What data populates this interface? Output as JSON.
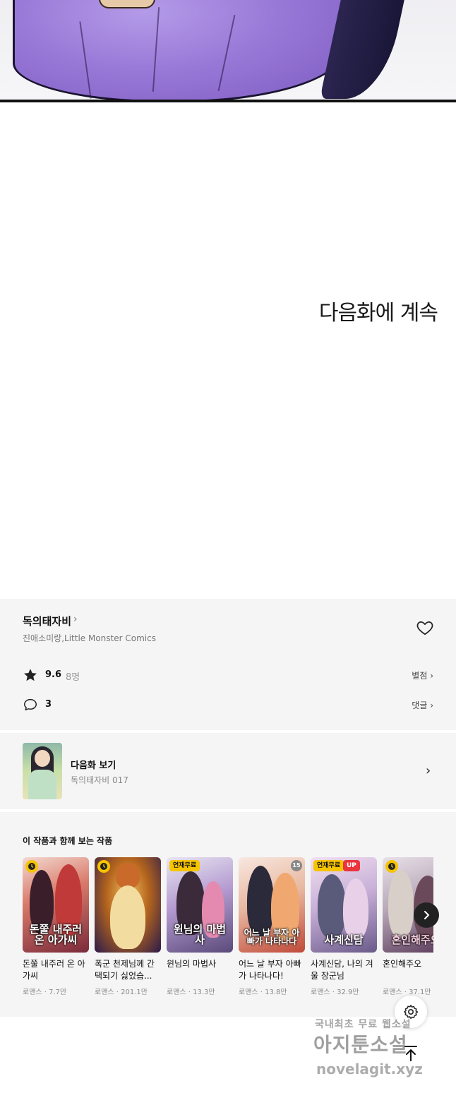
{
  "reader": {
    "continue_text": "다음화에 계속"
  },
  "series": {
    "title": "독의태자비",
    "title_chevron": "›",
    "authors": "진애소미랑,Little Monster Comics",
    "rating": "9.6",
    "rating_count": "8명",
    "rate_link": "별점 ›",
    "comment_count": "3",
    "comment_link": "댓글 ›"
  },
  "next_episode": {
    "label": "다음화 보기",
    "subtitle": "독의태자비 017",
    "chevron": "›"
  },
  "recommendations": {
    "heading": "이 작품과 함께 보는 작품",
    "items": [
      {
        "name": "돈쭐 내주러 온 아가씨",
        "meta": "로맨스 · 7.7만",
        "cover_text": "돈쭐 내주러 온 아가씨",
        "badge": "clock"
      },
      {
        "name": "폭군 천제님께 간택되기 싫었습...",
        "meta": "로맨스 · 201.1만",
        "cover_text": "",
        "badge": "clock"
      },
      {
        "name": "윈님의 마법사",
        "meta": "로맨스 · 13.3만",
        "cover_text": "윈님의 마법사",
        "badge": "free",
        "badge_label": "연재무료"
      },
      {
        "name": "어느 날 부자 아빠가 나타나다!",
        "meta": "로맨스 · 13.8만",
        "cover_text": "어느 날 부자 아빠가 나타나다",
        "badge": "age",
        "badge_label": "15"
      },
      {
        "name": "사계신담, 나의 겨울 장군님",
        "meta": "로맨스 · 32.9만",
        "cover_text": "사계신담",
        "badge": "free",
        "badge_label": "연재무료",
        "badge2": "UP"
      },
      {
        "name": "혼인해주오",
        "meta": "로맨스 · 37.1만",
        "cover_text": "혼인해주오",
        "badge": "clock"
      }
    ]
  },
  "watermark": {
    "line1": "국내최초 무료 웹소설",
    "line2": "아지툰소설",
    "line3": "novelagit.xyz"
  },
  "colors": {
    "section_bg": "#f5f5f6",
    "badge_yellow": "#f6c400",
    "badge_red": "#e9353b"
  },
  "icons": [
    "heart-icon",
    "star-icon",
    "comment-icon",
    "chevron-right-icon",
    "settings-icon",
    "arrow-up-icon",
    "clock-icon"
  ]
}
